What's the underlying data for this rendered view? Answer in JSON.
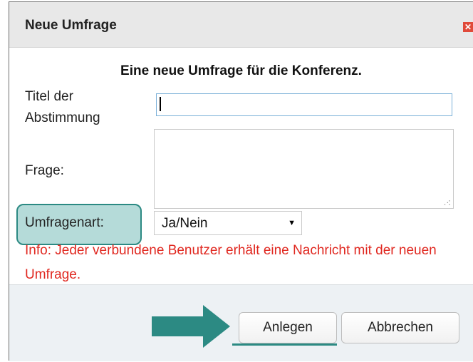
{
  "dialog": {
    "title": "Neue Umfrage",
    "close_icon": "close-icon",
    "heading": "Eine neue Umfrage für die Konferenz.",
    "fields": {
      "title_label": "Titel der Abstimmung",
      "title_value": "",
      "question_label": "Frage:",
      "question_value": "",
      "type_label": "Umfragenart:",
      "type_value": "Ja/Nein"
    },
    "info": "Info: Jeder verbundene Benutzer erhält eine Nachricht mit der neuen Umfrage.",
    "buttons": {
      "create": "Anlegen",
      "cancel": "Abbrechen"
    }
  },
  "colors": {
    "accent": "#2c8a83",
    "info_text": "#e0271f",
    "close": "#e04a3a"
  }
}
